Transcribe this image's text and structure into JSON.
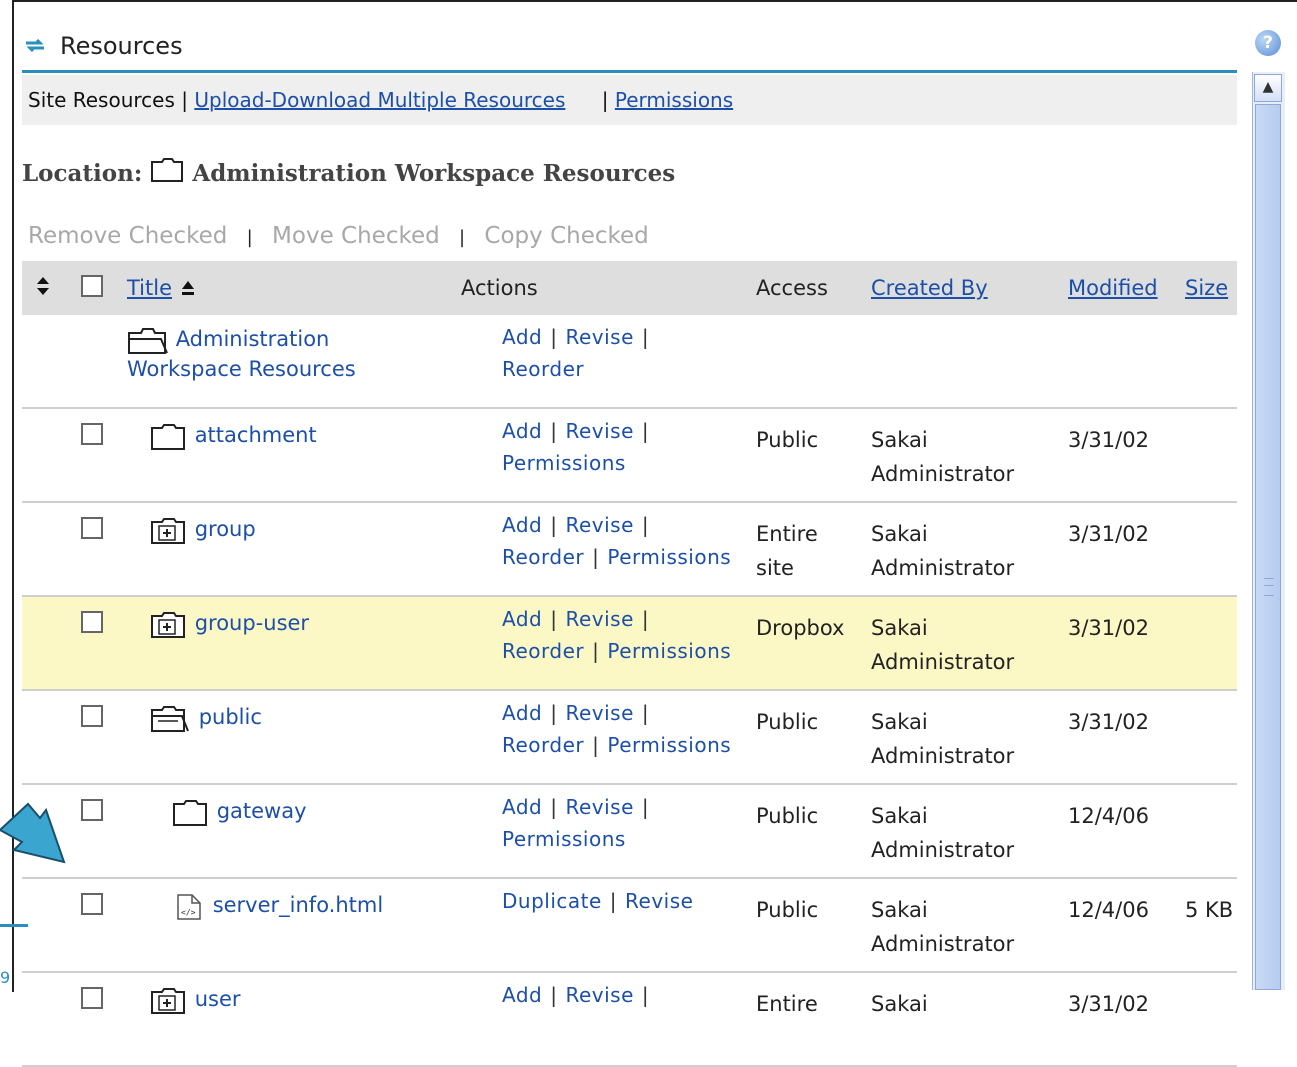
{
  "tool": {
    "title": "Resources",
    "help_label": "?"
  },
  "nav": {
    "site_resources": "Site Resources",
    "sep": "|",
    "upload_download": "Upload-Download Multiple Resources",
    "permissions": "Permissions"
  },
  "location": {
    "label": "Location:",
    "value": "Administration Workspace Resources"
  },
  "bulk_actions": {
    "remove": "Remove Checked",
    "move": "Move Checked",
    "copy": "Copy Checked",
    "sep": "|"
  },
  "table": {
    "headers": {
      "title": "Title",
      "actions": "Actions",
      "access": "Access",
      "created_by": "Created By",
      "modified": "Modified",
      "size": "Size"
    },
    "root": {
      "title_line1": "Administration",
      "title_line2": "Workspace Resources",
      "actions": [
        "Add",
        "Revise",
        "Reorder"
      ]
    },
    "rows": [
      {
        "icon": "folder-icon",
        "title": "attachment",
        "actions_line1": [
          "Add",
          "Revise"
        ],
        "actions_line2": [
          "Permissions"
        ],
        "access": "Public",
        "created_by_1": "Sakai",
        "created_by_2": "Administrator",
        "modified": "3/31/02",
        "size": ""
      },
      {
        "icon": "folder-plus-icon",
        "title": "group",
        "actions_line1": [
          "Add",
          "Revise"
        ],
        "actions_line2": [
          "Reorder",
          "Permissions"
        ],
        "access_1": "Entire",
        "access_2": "site",
        "created_by_1": "Sakai",
        "created_by_2": "Administrator",
        "modified": "3/31/02",
        "size": ""
      },
      {
        "icon": "folder-plus-icon",
        "title": "group-user",
        "actions_line1": [
          "Add",
          "Revise"
        ],
        "actions_line2": [
          "Reorder",
          "Permissions"
        ],
        "access": "Dropbox",
        "created_by_1": "Sakai",
        "created_by_2": "Administrator",
        "modified": "3/31/02",
        "size": ""
      },
      {
        "icon": "folder-open-icon",
        "title": "public",
        "actions_line1": [
          "Add",
          "Revise"
        ],
        "actions_line2": [
          "Reorder",
          "Permissions"
        ],
        "access": "Public",
        "created_by_1": "Sakai",
        "created_by_2": "Administrator",
        "modified": "3/31/02",
        "size": ""
      },
      {
        "icon": "folder-icon",
        "title": "gateway",
        "actions_line1": [
          "Add",
          "Revise"
        ],
        "actions_line2": [
          "Permissions"
        ],
        "access": "Public",
        "created_by_1": "Sakai",
        "created_by_2": "Administrator",
        "modified": "12/4/06",
        "size": ""
      },
      {
        "icon": "html-file-icon",
        "title": "server_info.html",
        "actions_line1": [
          "Duplicate",
          "Revise"
        ],
        "actions_line2": [],
        "access": "Public",
        "created_by_1": "Sakai",
        "created_by_2": "Administrator",
        "modified": "12/4/06",
        "size": "5 KB"
      },
      {
        "icon": "folder-plus-icon",
        "title": "user",
        "actions_line1": [
          "Add",
          "Revise"
        ],
        "actions_line2": [],
        "access_1": "Entire",
        "created_by_1": "Sakai",
        "modified": "3/31/02",
        "size": ""
      }
    ]
  },
  "corner_text": "9",
  "colors": {
    "accent": "#2a8fbf",
    "link": "#1c4fa8",
    "highlight_row": "#fbf8c6",
    "header_bg": "#dedede"
  }
}
